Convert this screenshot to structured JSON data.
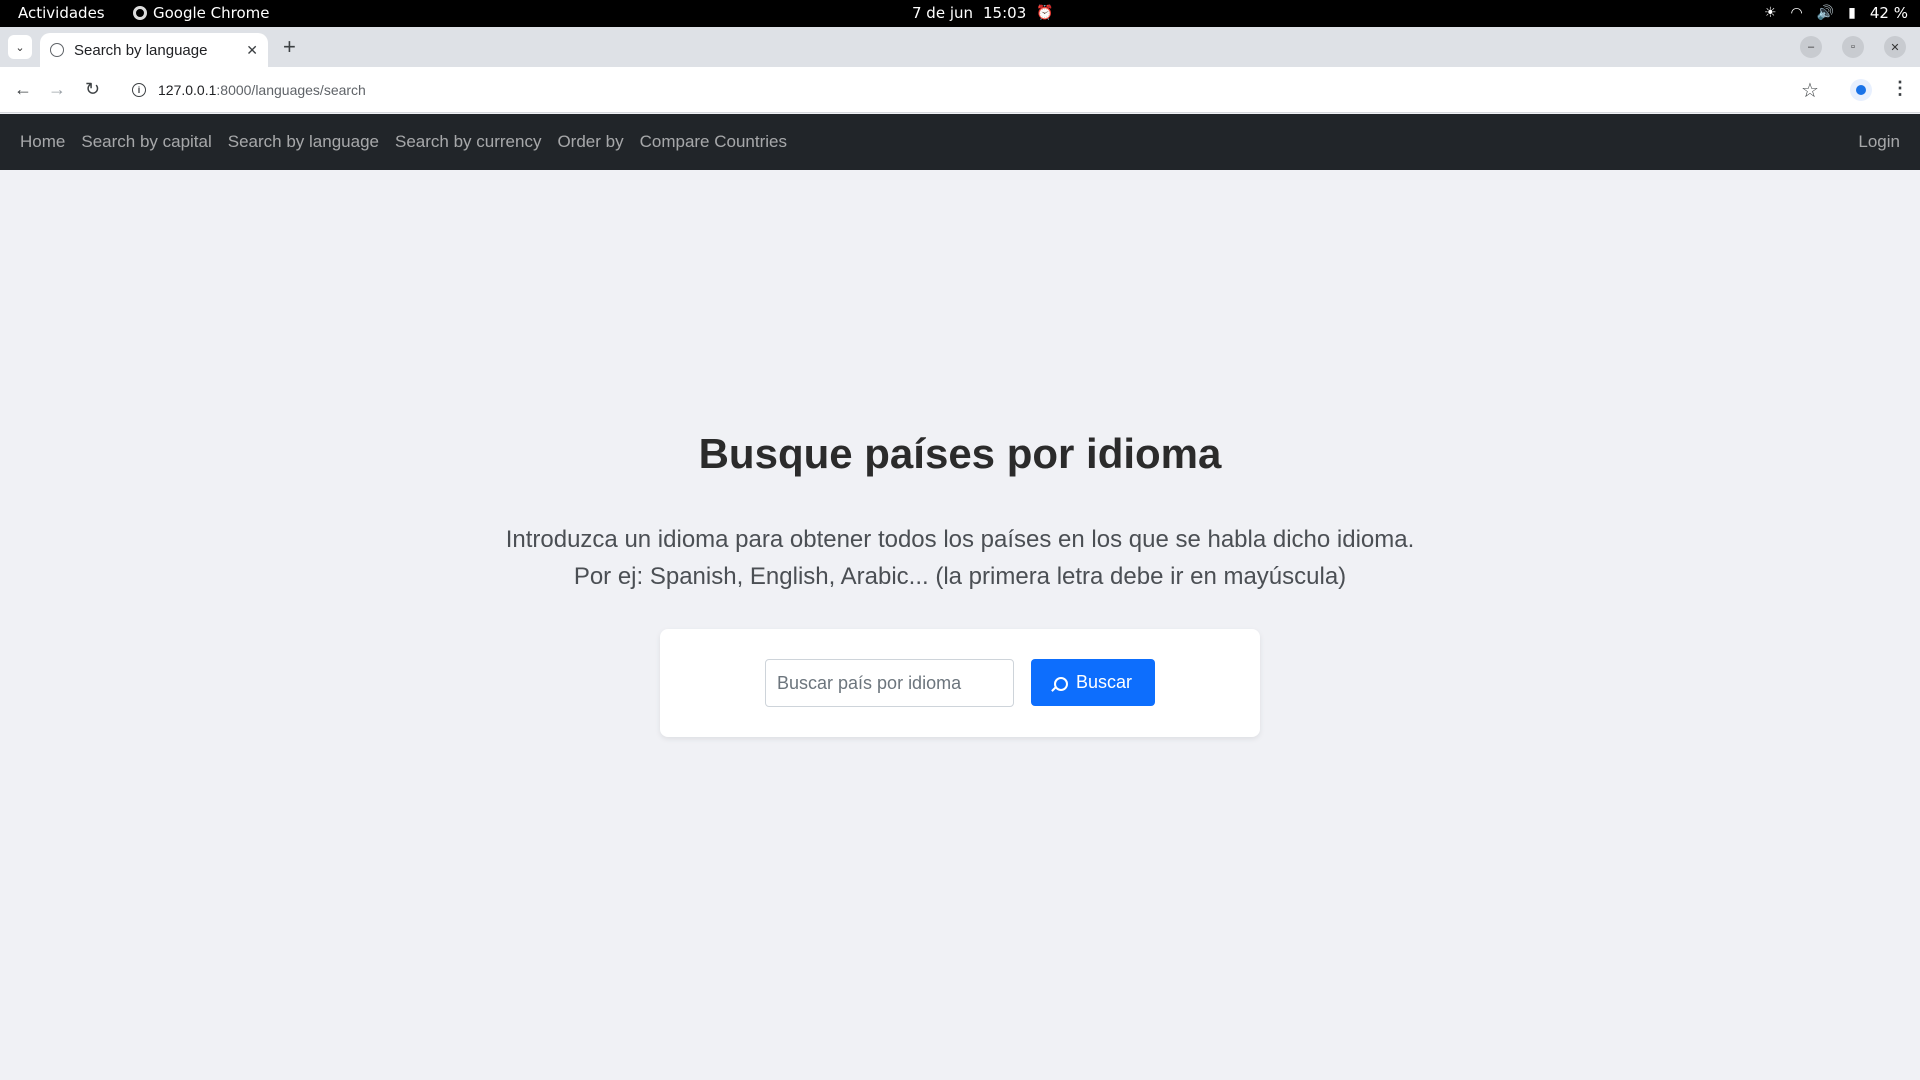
{
  "os_bar": {
    "activities": "Actividades",
    "app_name": "Google Chrome",
    "date": "7 de jun",
    "time": "15:03",
    "battery": "42 %"
  },
  "browser": {
    "tab_title": "Search by language",
    "url_host": "127.0.0.1",
    "url_path": ":8000/languages/search"
  },
  "navbar": {
    "items": [
      {
        "label": "Home"
      },
      {
        "label": "Search by capital"
      },
      {
        "label": "Search by language"
      },
      {
        "label": "Search by currency"
      },
      {
        "label": "Order by"
      },
      {
        "label": "Compare Countries"
      }
    ],
    "login": "Login"
  },
  "main": {
    "title": "Busque países por idioma",
    "lead_line1": "Introduzca un idioma para obtener todos los países en los que se habla dicho idioma.",
    "lead_line2": "Por ej: Spanish, English, Arabic... (la primera letra debe ir en mayúscula)"
  },
  "search": {
    "placeholder": "Buscar país por idioma",
    "value": "",
    "button_label": "Buscar"
  },
  "colors": {
    "navbar_bg": "#212529",
    "primary_button": "#0d6efd",
    "page_bg": "#f0f1f5"
  }
}
